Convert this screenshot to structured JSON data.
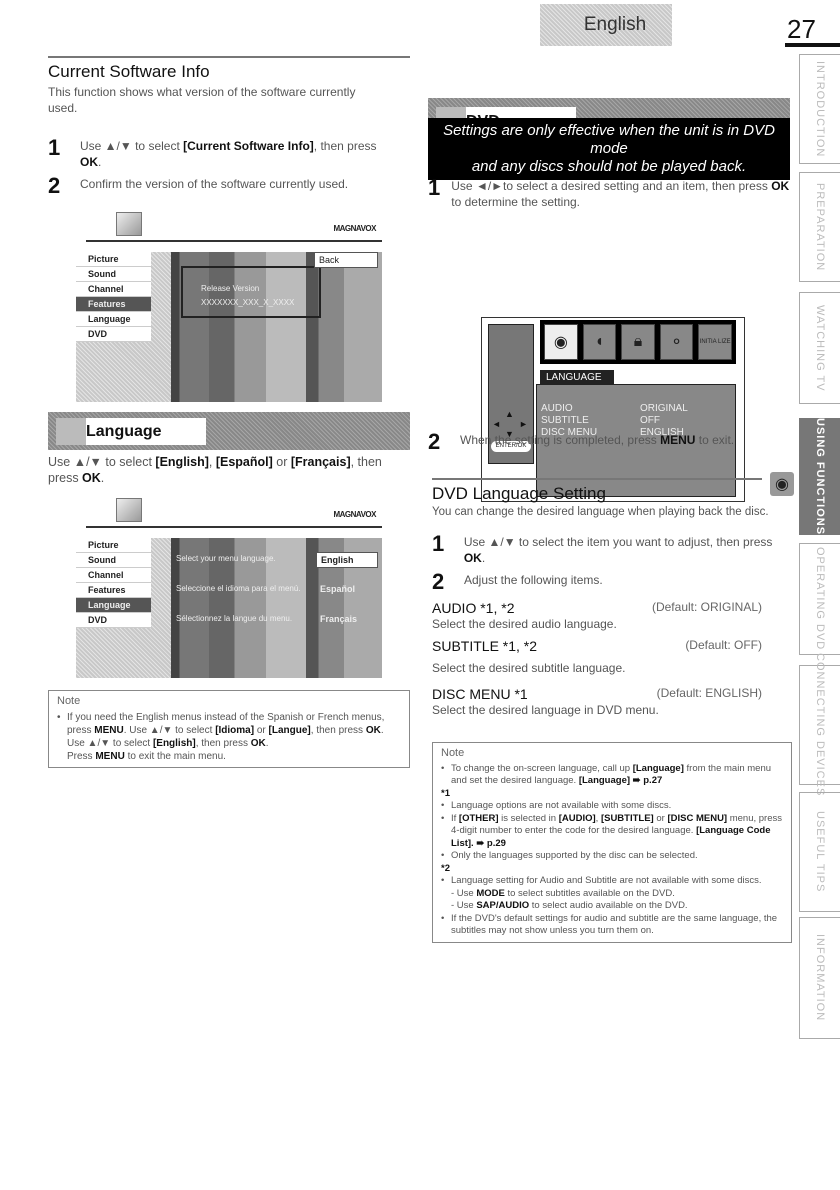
{
  "header": {
    "language_tab": "English",
    "page_number": "27"
  },
  "side_tabs": [
    {
      "label": "INTRODUCTION",
      "active": false
    },
    {
      "label": "PREPARATION",
      "active": false
    },
    {
      "label": "WATCHING TV",
      "active": false
    },
    {
      "label": "USING FUNCTIONS",
      "active": true
    },
    {
      "label": "OPERATING DVD",
      "active": false
    },
    {
      "label": "CONNECTING DEVICES",
      "active": false
    },
    {
      "label": "USEFUL TIPS",
      "active": false
    },
    {
      "label": "INFORMATION",
      "active": false
    }
  ],
  "software": {
    "title": "Current Software Info",
    "intro": "This function shows what version of the software currently used.",
    "step1_pre": "Use ▲/▼ to select ",
    "step1_bold": "[Current Software Info]",
    "step1_post": ", then press ",
    "step1_ok": "OK",
    "step2": "Confirm the version of the software currently used.",
    "screen": {
      "brand": "MAGNAVOX",
      "menu": [
        "Picture",
        "Sound",
        "Channel",
        "Features",
        "Language",
        "DVD"
      ],
      "selected": "Features",
      "release_label": "Release Version",
      "release_value": "XXXXXXX_XXX_X_XXXX",
      "back": "Back"
    }
  },
  "language": {
    "banner": "Language",
    "instr_pre": "Use ▲/▼ to select ",
    "opt1": "[English]",
    "opt2": "[Español]",
    "opt3": "[Français]",
    "instr_or": " or ",
    "instr_post": ", then press ",
    "ok": "OK",
    "screen": {
      "brand": "MAGNAVOX",
      "menu": [
        "Picture",
        "Sound",
        "Channel",
        "Features",
        "Language",
        "DVD"
      ],
      "selected": "Language",
      "prompts": [
        "Select your menu language.",
        "Seleccione el idioma para el menú.",
        "Sélectionnez la langue du menu."
      ],
      "options": [
        "English",
        "Español",
        "Français"
      ]
    },
    "note": {
      "title": "Note",
      "line1": "If you need the English menus instead of the Spanish or French menus, press",
      "menu": "MENU",
      "line1b": ". Use ▲/▼ to select",
      "idioma": "[Idioma]",
      "or": "or",
      "langue": "[Langue]",
      "then": ", then press",
      "ok": "OK",
      "line2a": "Use ▲/▼ to select",
      "english": "[English]",
      "line2b": ", then press",
      "line3a": "Press",
      "line3b": "to exit the main menu."
    }
  },
  "dvd": {
    "banner": "DVD",
    "warning_line1": "Settings are only effective when the unit is in DVD mode",
    "warning_line2": "and any discs should not be played back.",
    "step1_pre": "Use ◄/►to select a desired setting and an item, then press ",
    "step1_ok": "OK",
    "step1_post": " to determine the setting.",
    "osd": {
      "tab": "LANGUAGE",
      "rows": [
        {
          "key": "AUDIO",
          "value": "ORIGINAL"
        },
        {
          "key": "SUBTITLE",
          "value": "OFF"
        },
        {
          "key": "DISC MENU",
          "value": "ENGLISH"
        }
      ],
      "enter_label": "ENTER/OK",
      "icons": [
        "language-icon",
        "audio-icon",
        "lock-icon",
        "others-icon",
        "initialize-icon"
      ],
      "initialize_text": "INITIA LIZE"
    },
    "step2_pre": "When the setting is completed, press ",
    "step2_menu": "MENU",
    "step2_post": " to exit."
  },
  "dvd_language": {
    "title": "DVD Language Setting",
    "intro": "You can change the desired language when playing back the disc.",
    "step1_pre": "Use ▲/▼ to select the item you want to adjust, then press ",
    "step1_ok": "OK",
    "step2": "Adjust the following items.",
    "items": [
      {
        "name": "AUDIO *1, *2",
        "default": "(Default: ORIGINAL)",
        "desc": "Select the desired audio language."
      },
      {
        "name": "SUBTITLE *1, *2",
        "default": "(Default: OFF)",
        "desc": "Select the desired subtitle language."
      },
      {
        "name": "DISC MENU *1",
        "default": "(Default: ENGLISH)",
        "desc": "Select the desired language in DVD menu."
      }
    ],
    "note": {
      "title": "Note",
      "b1_pre": "To change the on-screen language, call up ",
      "b1_lang": "[Language]",
      "b1_mid": " from the main menu and set the desired language. ",
      "b1_ref": "[Language] ➠ p.27",
      "star1": "*1",
      "s1_b1": "Language options are not available with some discs.",
      "s1_b2_a": "If ",
      "s1_b2_other": "[OTHER]",
      "s1_b2_b": " is selected in ",
      "s1_b2_audio": "[AUDIO]",
      "s1_b2_sub": "[SUBTITLE]",
      "s1_b2_or": " or ",
      "s1_b2_disc": "[DISC MENU]",
      "s1_b2_c": " menu, press 4-digit number to enter the code for the desired language. ",
      "s1_b2_ref": "[Language Code List]. ➠ p.29",
      "s1_b3": "Only the languages supported by the disc can be selected.",
      "star2": "*2",
      "s2_b1": "Language setting for Audio and Subtitle are not available with some discs.",
      "s2_d1_a": "- Use ",
      "s2_d1_mode": "MODE",
      "s2_d1_b": " to select subtitles available on the DVD.",
      "s2_d2_a": "- Use ",
      "s2_d2_sap": "SAP/AUDIO",
      "s2_d2_b": " to select audio available on the DVD.",
      "s2_b2": "If the DVD's default settings for audio and subtitle are the same language, the subtitles may not show unless you turn them on."
    }
  }
}
